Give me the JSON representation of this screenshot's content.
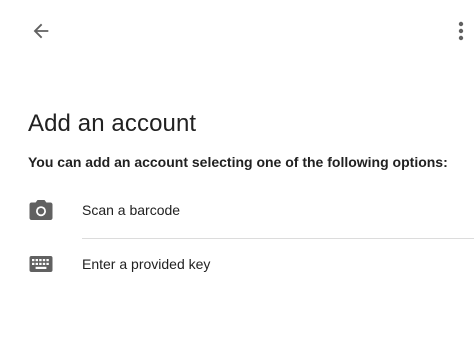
{
  "app_bar": {
    "back_icon": "arrow-left-icon",
    "overflow_icon": "more-vert-icon"
  },
  "page": {
    "title": "Add an account",
    "instructions": "You can add an account selecting one of the following options:"
  },
  "options": [
    {
      "label": "Scan a barcode",
      "icon": "camera-icon"
    },
    {
      "label": "Enter a provided key",
      "icon": "keyboard-icon"
    }
  ],
  "colors": {
    "icon": "#616161",
    "text": "#212121",
    "divider": "#dcdcdc"
  }
}
